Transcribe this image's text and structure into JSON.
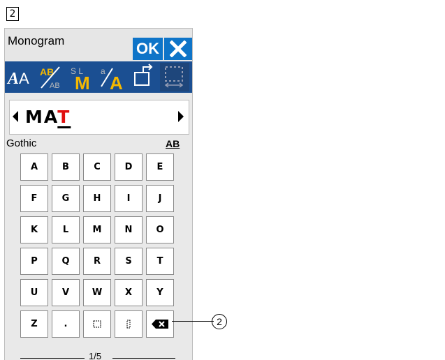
{
  "step_label": "2",
  "window": {
    "title": "Monogram",
    "ok_label": "OK"
  },
  "toolbar": [
    {
      "icon": "font-style-icon"
    },
    {
      "icon": "text-direction-icon"
    },
    {
      "icon": "letter-size-icon"
    },
    {
      "icon": "text-size-icon"
    },
    {
      "icon": "page-back-icon"
    },
    {
      "icon": "placement-icon"
    }
  ],
  "display": {
    "text_before_cursor": "MA",
    "cursor_char": "T"
  },
  "font_name": "Gothic",
  "size_indicator": "AB",
  "keys": [
    "A",
    "B",
    "C",
    "D",
    "E",
    "F",
    "G",
    "H",
    "I",
    "J",
    "K",
    "L",
    "M",
    "N",
    "O",
    "P",
    "Q",
    "R",
    "S",
    "T",
    "U",
    "V",
    "W",
    "X",
    "Y",
    "Z",
    ".",
    "",
    ""
  ],
  "pager": "1/5",
  "callout": "2",
  "colors": {
    "ok_blue": "#0e74c8",
    "toolbar_blue": "#1b4f92",
    "accent_yellow": "#f5b800",
    "cursor_red": "#e01010"
  }
}
